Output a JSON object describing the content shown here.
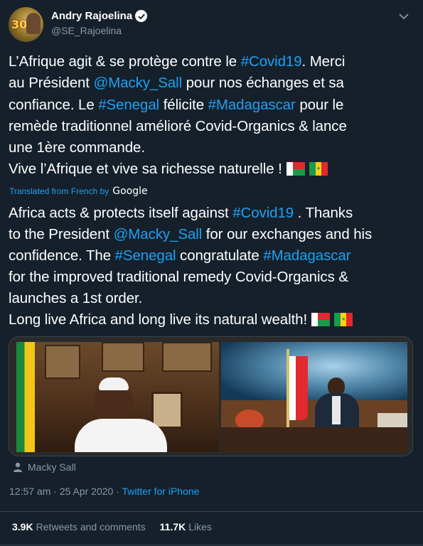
{
  "author": {
    "name": "Andry Rajoelina",
    "handle": "@SE_Rajoelina",
    "avatar_text": "30"
  },
  "tweet": {
    "lines": [
      [
        {
          "t": "L’Afrique agit & se protège contre le ",
          "link": false
        },
        {
          "t": "#Covid19",
          "link": true
        },
        {
          "t": ". Merci",
          "link": false
        }
      ],
      [
        {
          "t": "au Président ",
          "link": false
        },
        {
          "t": "@Macky_Sall",
          "link": true
        },
        {
          "t": " pour nos échanges et sa",
          "link": false
        }
      ],
      [
        {
          "t": "confiance. Le ",
          "link": false
        },
        {
          "t": "#Senegal",
          "link": true
        },
        {
          "t": " félicite ",
          "link": false
        },
        {
          "t": "#Madagascar",
          "link": true
        },
        {
          "t": " pour le",
          "link": false
        }
      ],
      [
        {
          "t": "remède traditionnel amélioré Covid-Organics & lance",
          "link": false
        }
      ],
      [
        {
          "t": "une 1ère commande.",
          "link": false
        }
      ],
      [
        {
          "t": "Vive l’Afrique et vive sa richesse naturelle !",
          "link": false
        }
      ]
    ]
  },
  "translation_label": "Translated from French by",
  "translation_provider": "Google",
  "translation": {
    "lines": [
      [
        {
          "t": "Africa acts & protects itself against ",
          "link": false
        },
        {
          "t": "#Covid19",
          "link": true
        },
        {
          "t": " . Thanks",
          "link": false
        }
      ],
      [
        {
          "t": "to the President ",
          "link": false
        },
        {
          "t": "@Macky_Sall",
          "link": true
        },
        {
          "t": " for our exchanges and his",
          "link": false
        }
      ],
      [
        {
          "t": "confidence. The ",
          "link": false
        },
        {
          "t": "#Senegal",
          "link": true
        },
        {
          "t": " congratulate ",
          "link": false
        },
        {
          "t": "#Madagascar",
          "link": true
        }
      ],
      [
        {
          "t": "for the improved traditional remedy Covid-Organics &",
          "link": false
        }
      ],
      [
        {
          "t": "launches a 1st order.",
          "link": false
        }
      ],
      [
        {
          "t": " Long live Africa and long live its natural wealth!",
          "link": false
        }
      ]
    ]
  },
  "tagged_user": "Macky Sall",
  "timestamp": "12:57 am · 25 Apr 2020 ·",
  "source": "Twitter for iPhone",
  "stats": {
    "retweets_count": "3.9K",
    "retweets_label": "Retweets and comments",
    "likes_count": "11.7K",
    "likes_label": "Likes"
  },
  "colors": {
    "background": "#15202b",
    "link": "#1da1f2",
    "secondary_text": "#8899a6",
    "divider": "#38444d"
  },
  "icons": [
    "verified-badge-icon",
    "chevron-down-icon",
    "person-icon",
    "madagascar-flag-icon",
    "senegal-flag-icon",
    "google-logo"
  ]
}
